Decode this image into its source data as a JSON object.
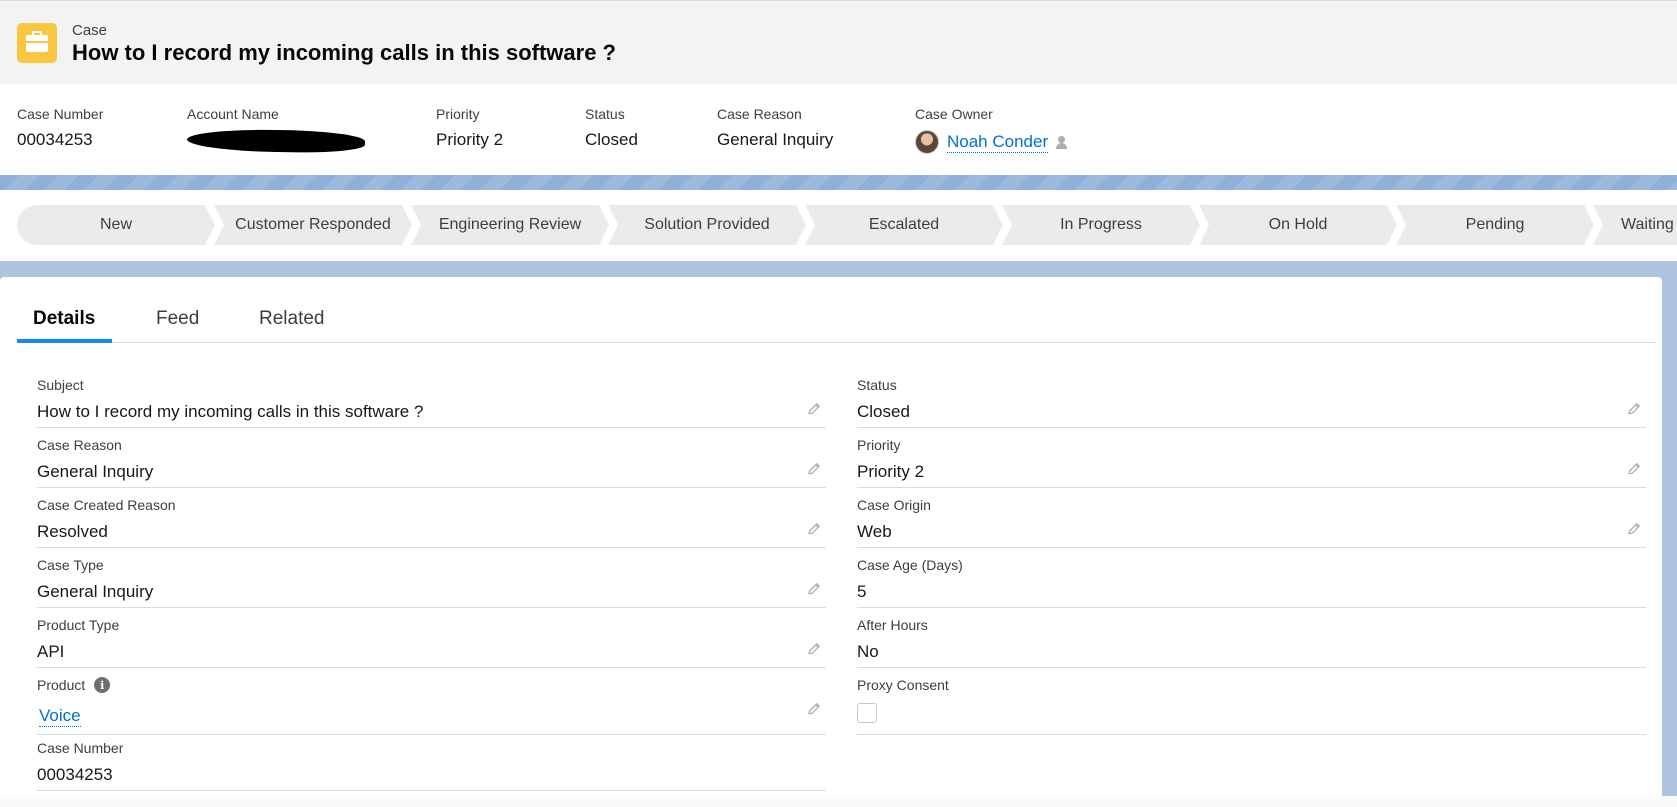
{
  "header": {
    "object_label": "Case",
    "title": "How to I record my incoming calls in this software ?"
  },
  "highlights": {
    "case_number": {
      "label": "Case Number",
      "value": "00034253"
    },
    "account_name": {
      "label": "Account Name",
      "value": "[redacted]"
    },
    "priority": {
      "label": "Priority",
      "value": "Priority 2"
    },
    "status": {
      "label": "Status",
      "value": "Closed"
    },
    "case_reason": {
      "label": "Case Reason",
      "value": "General Inquiry"
    },
    "case_owner": {
      "label": "Case Owner",
      "value": "Noah Conder"
    }
  },
  "path": {
    "stages": [
      "New",
      "Customer Responded",
      "Engineering Review",
      "Solution Provided",
      "Escalated",
      "In Progress",
      "On Hold",
      "Pending",
      "Waiting"
    ]
  },
  "tabs": [
    "Details",
    "Feed",
    "Related"
  ],
  "details": {
    "left": [
      {
        "label": "Subject",
        "value": "How to I record my incoming calls in this software ?",
        "editable": true
      },
      {
        "label": "Case Reason",
        "value": "General Inquiry",
        "editable": true
      },
      {
        "label": "Case Created Reason",
        "value": "Resolved",
        "editable": true
      },
      {
        "label": "Case Type",
        "value": "General Inquiry",
        "editable": true
      },
      {
        "label": "Product Type",
        "value": "API",
        "editable": true
      },
      {
        "label": "Product",
        "value": "Voice",
        "editable": true,
        "link": true,
        "info_icon": "info-icon"
      },
      {
        "label": "Case Number",
        "value": "00034253",
        "editable": false
      }
    ],
    "right": [
      {
        "label": "Status",
        "value": "Closed",
        "editable": true
      },
      {
        "label": "Priority",
        "value": "Priority 2",
        "editable": true
      },
      {
        "label": "Case Origin",
        "value": "Web",
        "editable": true
      },
      {
        "label": "Case Age (Days)",
        "value": "5",
        "editable": false
      },
      {
        "label": "After Hours",
        "value": "No",
        "editable": false
      },
      {
        "label": "Proxy Consent",
        "value": "",
        "checkbox": true,
        "checked": false
      }
    ]
  },
  "colors": {
    "accent": "#1589ee",
    "link": "#0070d2",
    "case_icon": "#f9c642",
    "band": "#b0c4df"
  }
}
